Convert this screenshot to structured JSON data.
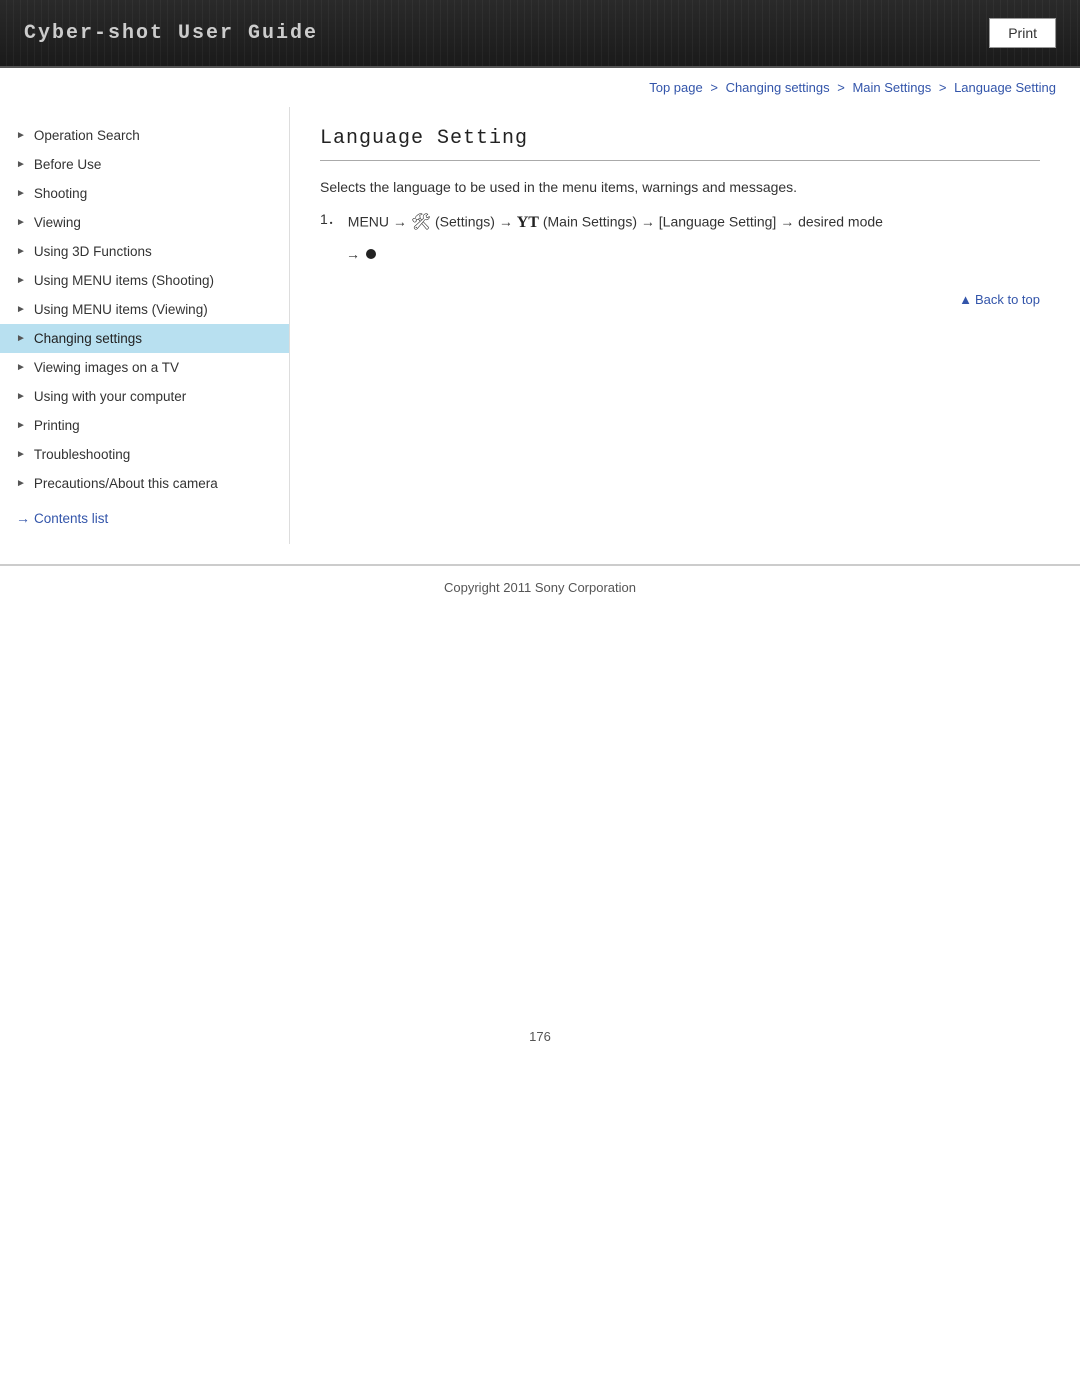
{
  "header": {
    "title": "Cyber-shot User Guide",
    "print_button": "Print"
  },
  "breadcrumb": {
    "top_page": "Top page",
    "sep1": " > ",
    "changing_settings": "Changing settings",
    "sep2": " > ",
    "main_settings": "Main Settings",
    "sep3": " > ",
    "current": "Language Setting"
  },
  "sidebar": {
    "items": [
      {
        "id": "operation-search",
        "label": "Operation Search",
        "active": false
      },
      {
        "id": "before-use",
        "label": "Before Use",
        "active": false
      },
      {
        "id": "shooting",
        "label": "Shooting",
        "active": false
      },
      {
        "id": "viewing",
        "label": "Viewing",
        "active": false
      },
      {
        "id": "using-3d-functions",
        "label": "Using 3D Functions",
        "active": false
      },
      {
        "id": "using-menu-items-shooting",
        "label": "Using MENU items (Shooting)",
        "active": false
      },
      {
        "id": "using-menu-items-viewing",
        "label": "Using MENU items (Viewing)",
        "active": false
      },
      {
        "id": "changing-settings",
        "label": "Changing settings",
        "active": true
      },
      {
        "id": "viewing-images-on-tv",
        "label": "Viewing images on a TV",
        "active": false
      },
      {
        "id": "using-with-computer",
        "label": "Using with your computer",
        "active": false
      },
      {
        "id": "printing",
        "label": "Printing",
        "active": false
      },
      {
        "id": "troubleshooting",
        "label": "Troubleshooting",
        "active": false
      },
      {
        "id": "precautions",
        "label": "Precautions/About this camera",
        "active": false
      }
    ],
    "contents_list": "Contents list"
  },
  "content": {
    "page_title": "Language Setting",
    "description": "Selects the language to be used in the menu items, warnings and messages.",
    "step": {
      "number": "1．",
      "text_before_settings": "MENU",
      "settings_label": "(Settings)",
      "text_before_main": "",
      "main_settings_label": "(Main Settings)",
      "text_after": "→ [Language Setting] → desired mode",
      "line2_arrow": "→",
      "line2_bullet": "●"
    },
    "back_to_top": "Back to top"
  },
  "footer": {
    "copyright": "Copyright 2011 Sony Corporation",
    "page_number": "176"
  }
}
